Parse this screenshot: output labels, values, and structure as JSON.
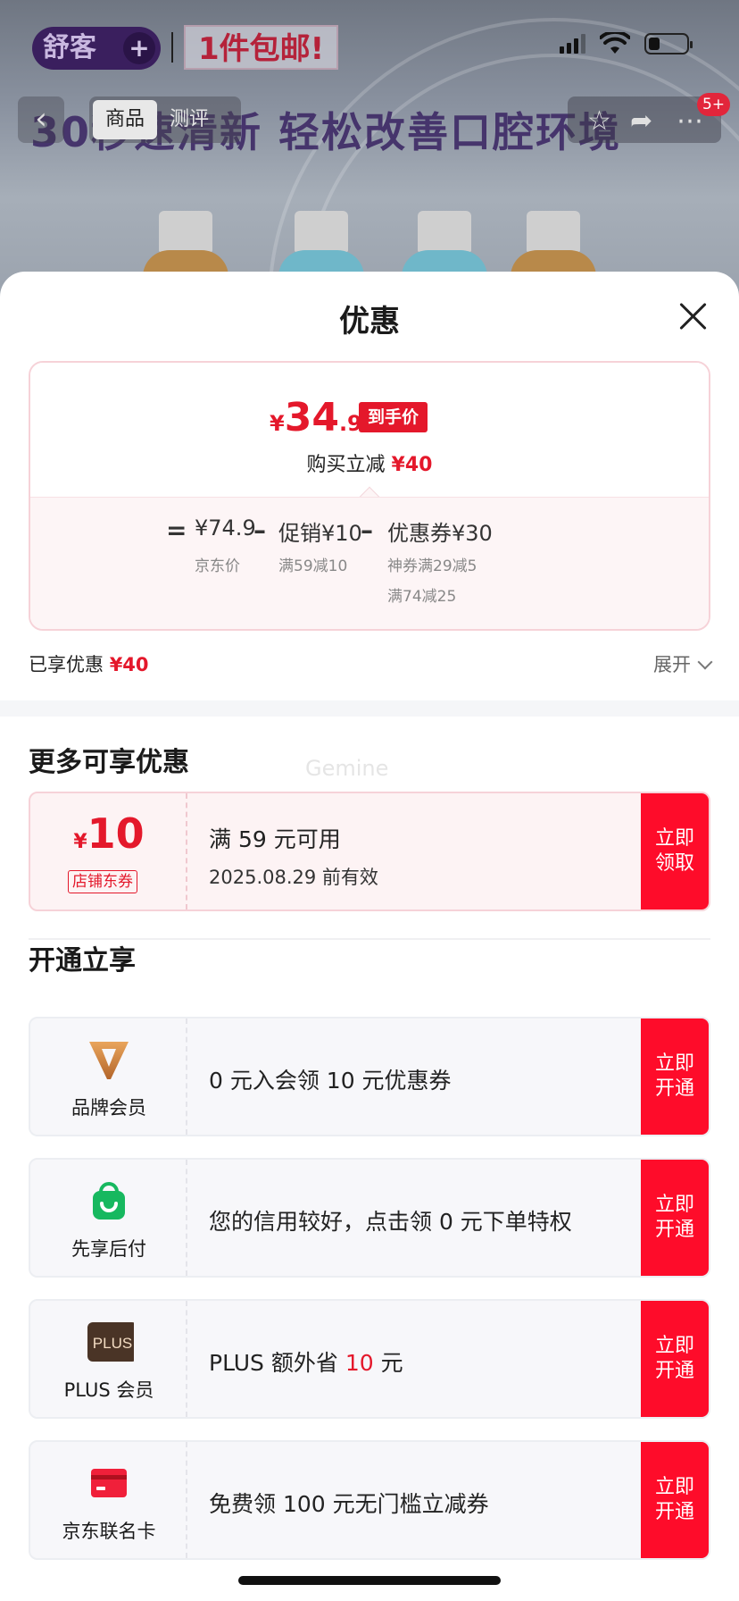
{
  "status_bar": {
    "brand_text": "舒客",
    "brand_plus": "+",
    "banner_tag": "1件包邮!"
  },
  "product_page": {
    "headline": "30秒速清新 轻松改善口腔环境",
    "tabs": [
      "商品",
      "测评"
    ],
    "cart_badge": "5+"
  },
  "sheet": {
    "title": "优惠",
    "price_card": {
      "currency": "¥",
      "price_int": "34",
      "price_dec": ".9",
      "final_tag": "到手价",
      "instant_label": "购买立减",
      "instant_value": "¥40",
      "calc": {
        "eq": "=",
        "minus1": "–",
        "minus2": "–",
        "jd_price": "¥74.9",
        "jd_price_label": "京东价",
        "promo": "促销¥10",
        "promo_desc": "满59减10",
        "coupon": "优惠券¥30",
        "coupon_desc_1": "神券满29减5",
        "coupon_desc_2": "满74减25"
      }
    },
    "enjoyed_label": "已享优惠",
    "enjoyed_value": "¥40",
    "expand_label": "展开",
    "more_title": "更多可享优惠",
    "watermark": "Gemine",
    "coupon": {
      "currency": "¥",
      "amount": "10",
      "kind": "店铺东券",
      "condition": "满 59 元可用",
      "validity": "2025.08.29 前有效",
      "cta": "立即领取"
    },
    "open_title": "开通立享",
    "benefits": [
      {
        "name": "品牌会员",
        "icon": "brand-v-icon",
        "text": "0 元入会领 10 元优惠券",
        "cta": "立即开通"
      },
      {
        "name": "先享后付",
        "icon": "shopping-bag-icon",
        "text": "您的信用较好，点击领 0 元下单特权",
        "cta": "立即开通"
      },
      {
        "name": "PLUS 会员",
        "icon": "plus-badge-icon",
        "icon_text": "PLUS",
        "text_pre": "PLUS 额外省 ",
        "text_red": "10",
        "text_post": " 元",
        "cta": "立即开通"
      },
      {
        "name": "京东联名卡",
        "icon": "credit-card-icon",
        "text": "免费领 100 元无门槛立减券",
        "cta": "立即开通"
      }
    ]
  },
  "colors": {
    "accent_red": "#e4182b",
    "cta_red": "#fe0c2a",
    "coupon_bg": "#fdf3f4",
    "benefit_bg": "#f7f7fa"
  }
}
